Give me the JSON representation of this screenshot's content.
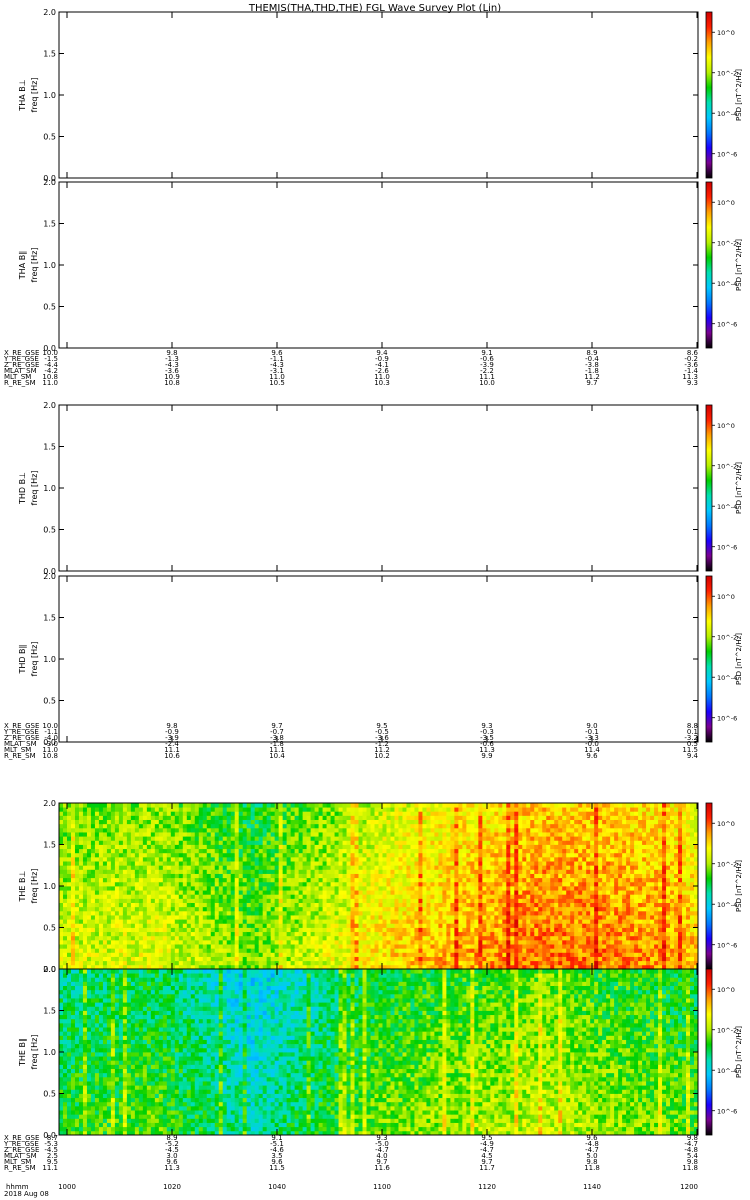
{
  "chart_data": {
    "type": "heatmap",
    "title": "THEMIS(THA,THD,THE) FGL Wave Survey Plot (Lin)",
    "x_unit_label": "hhmm",
    "date_label": "2018 Aug 08",
    "time_ticks": [
      "1000",
      "1020",
      "1040",
      "1100",
      "1120",
      "1140",
      "1200"
    ],
    "colorbar": {
      "label": "PSD [nT^2/Hz]",
      "ticks": [
        "10^0",
        "10^-2",
        "10^-4",
        "10^-6"
      ],
      "log_range": [
        -7.2,
        1.0
      ],
      "colors": [
        "#000000",
        "#7a0090",
        "#1a00ff",
        "#0078ff",
        "#00c8ff",
        "#00e0b0",
        "#00d000",
        "#b8f000",
        "#ffff00",
        "#ffa000",
        "#ff2000",
        "#d00000"
      ]
    },
    "panels": [
      {
        "id": "tha-bperp",
        "ylabel": "THA B⊥",
        "ylabel2": "freq [Hz]",
        "ylim": [
          0,
          2
        ],
        "yticks": [
          "0.0",
          "0.5",
          "1.0",
          "1.5",
          "2.0"
        ],
        "has_data": false
      },
      {
        "id": "tha-bpar",
        "ylabel": "THA B∥",
        "ylabel2": "freq [Hz]",
        "ylim": [
          0,
          2
        ],
        "yticks": [
          "0.0",
          "0.5",
          "1.0",
          "1.5",
          "2.0"
        ],
        "has_data": false
      },
      {
        "id": "thd-bperp",
        "ylabel": "THD B⊥",
        "ylabel2": "freq [Hz]",
        "ylim": [
          0,
          2
        ],
        "yticks": [
          "0.0",
          "0.5",
          "1.0",
          "1.5",
          "2.0"
        ],
        "has_data": false
      },
      {
        "id": "thd-bpar",
        "ylabel": "THD B∥",
        "ylabel2": "freq [Hz]",
        "ylim": [
          0,
          2
        ],
        "yticks": [
          "0.0",
          "0.5",
          "1.0",
          "1.5",
          "2.0"
        ],
        "has_data": false
      },
      {
        "id": "the-bperp",
        "ylabel": "THE B⊥",
        "ylabel2": "freq [Hz]",
        "ylim": [
          0,
          2
        ],
        "yticks": [
          "0.0",
          "0.5",
          "1.0",
          "1.5",
          "2.0"
        ],
        "has_data": true,
        "spectrogram_profile": {
          "time_fraction": [
            0.0,
            0.15,
            0.3,
            0.33,
            0.5,
            0.6,
            0.7,
            0.75,
            0.85,
            0.95,
            1.0
          ],
          "log_psd": [
            -2.0,
            -1.8,
            -2.6,
            -2.4,
            -1.4,
            -1.0,
            -0.7,
            -0.5,
            -0.6,
            -0.8,
            -1.2
          ]
        }
      },
      {
        "id": "the-bpar",
        "ylabel": "THE B∥",
        "ylabel2": "freq [Hz]",
        "ylim": [
          0,
          2
        ],
        "yticks": [
          "0.0",
          "0.5",
          "1.0",
          "1.5",
          "2.0"
        ],
        "has_data": true,
        "spectrogram_profile": {
          "time_fraction": [
            0.0,
            0.15,
            0.3,
            0.33,
            0.5,
            0.6,
            0.7,
            0.75,
            0.85,
            0.95,
            1.0
          ],
          "log_psd": [
            -3.0,
            -2.8,
            -3.8,
            -3.6,
            -2.6,
            -2.4,
            -2.2,
            -2.0,
            -2.4,
            -2.6,
            -2.8
          ]
        }
      }
    ],
    "ephemeris_blocks": [
      {
        "id": "tha",
        "rows": [
          {
            "label": "X_RE_GSE",
            "values": [
              "10.0",
              "9.8",
              "9.6",
              "9.4",
              "9.1",
              "8.9",
              "8.6"
            ]
          },
          {
            "label": "Y_RE_GSE",
            "values": [
              "-1.5",
              "-1.3",
              "-1.1",
              "-0.9",
              "-0.6",
              "-0.4",
              "-0.2"
            ]
          },
          {
            "label": "Z_RE_GSE",
            "values": [
              "-4.4",
              "-4.3",
              "-4.3",
              "-4.1",
              "-3.9",
              "-3.8",
              "-3.6"
            ]
          },
          {
            "label": "MLAT_SM",
            "values": [
              "-4.2",
              "-3.6",
              "-3.1",
              "-2.6",
              "-2.2",
              "-1.8",
              "-1.4"
            ]
          },
          {
            "label": "MLT_SM",
            "values": [
              "10.8",
              "10.9",
              "11.0",
              "11.0",
              "11.1",
              "11.2",
              "11.3"
            ]
          },
          {
            "label": "R_RE_SM",
            "values": [
              "11.0",
              "10.8",
              "10.5",
              "10.3",
              "10.0",
              "9.7",
              "9.3"
            ]
          }
        ]
      },
      {
        "id": "thd",
        "rows": [
          {
            "label": "X_RE_GSE",
            "values": [
              "10.0",
              "9.8",
              "9.7",
              "9.5",
              "9.3",
              "9.0",
              "8.8"
            ]
          },
          {
            "label": "Y_RE_GSE",
            "values": [
              "-1.1",
              "-0.9",
              "-0.7",
              "-0.5",
              "-0.3",
              "-0.1",
              "0.1"
            ]
          },
          {
            "label": "Z_RE_GSE",
            "values": [
              "-4.0",
              "-3.9",
              "-3.8",
              "-3.6",
              "-3.5",
              "-3.3",
              "-3.2"
            ]
          },
          {
            "label": "MLAT_SM",
            "values": [
              "-3.0",
              "-2.4",
              "-1.8",
              "-1.2",
              "-0.6",
              "-0.0",
              "0.5"
            ]
          },
          {
            "label": "MLT_SM",
            "values": [
              "11.0",
              "11.1",
              "11.1",
              "11.2",
              "11.3",
              "11.4",
              "11.5"
            ]
          },
          {
            "label": "R_RE_SM",
            "values": [
              "10.8",
              "10.6",
              "10.4",
              "10.2",
              "9.9",
              "9.6",
              "9.4"
            ]
          }
        ]
      },
      {
        "id": "the",
        "rows": [
          {
            "label": "X_RE_GSE",
            "values": [
              "8.7",
              "8.9",
              "9.1",
              "9.3",
              "9.5",
              "9.6",
              "9.8"
            ]
          },
          {
            "label": "Y_RE_GSE",
            "values": [
              "-5.3",
              "-5.2",
              "-5.1",
              "-5.0",
              "-4.9",
              "-4.8",
              "-4.7"
            ]
          },
          {
            "label": "Z_RE_GSE",
            "values": [
              "-4.5",
              "-4.5",
              "-4.6",
              "-4.7",
              "-4.7",
              "-4.7",
              "-4.8"
            ]
          },
          {
            "label": "MLAT_SM",
            "values": [
              "2.5",
              "3.0",
              "3.5",
              "4.0",
              "4.5",
              "5.0",
              "5.4"
            ]
          },
          {
            "label": "MLT_SM",
            "values": [
              "9.5",
              "9.6",
              "9.6",
              "9.7",
              "9.7",
              "9.8",
              "9.8"
            ]
          },
          {
            "label": "R_RE_SM",
            "values": [
              "11.1",
              "11.3",
              "11.5",
              "11.6",
              "11.7",
              "11.8",
              "11.8"
            ]
          }
        ]
      }
    ]
  }
}
